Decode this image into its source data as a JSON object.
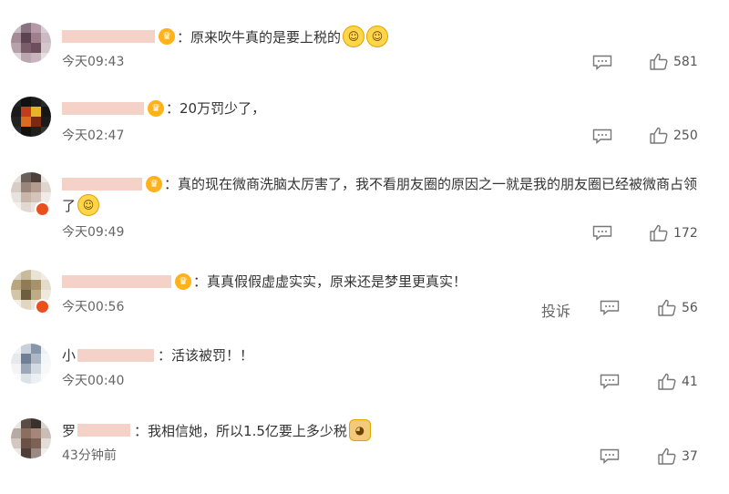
{
  "colors": {
    "accent": "#ffb21a",
    "vip_badge": "#e8501f",
    "text": "#333333",
    "muted": "#666666"
  },
  "comments": [
    {
      "name_visible": "",
      "separator": "：",
      "text": "原来吹牛真的是要上税的",
      "emoji": [
        "laugh-cry-emoji",
        "laugh-cry-emoji"
      ],
      "time": "今天09:43",
      "likes": "581"
    },
    {
      "name_visible": "",
      "separator": "：",
      "text": "20万罚少了，",
      "emoji": [],
      "time": "今天02:47",
      "likes": "250"
    },
    {
      "name_visible": "",
      "separator": "：",
      "text": "真的现在微商洗脑太厉害了，我不看朋友圈的原因之一就是我的朋友圈已经被微商占领",
      "text_line2": "了",
      "emoji": [
        "laugh-cry-emoji"
      ],
      "time": "今天09:49",
      "likes": "172"
    },
    {
      "name_visible": "",
      "separator": "：",
      "text": "真真假假虚虚实实，原来还是梦里更真实！",
      "emoji": [],
      "time": "今天00:56",
      "likes": "56",
      "report": "投诉"
    },
    {
      "name_visible": "小",
      "separator": "：",
      "text": "活该被罚！！",
      "emoji": [],
      "time": "今天00:40",
      "likes": "41"
    },
    {
      "name_visible": "罗",
      "separator": "：",
      "text": "我相信她，所以1.5亿要上多少税",
      "emoji": [
        "doge-emoji"
      ],
      "time": "43分钟前",
      "likes": "37"
    }
  ]
}
